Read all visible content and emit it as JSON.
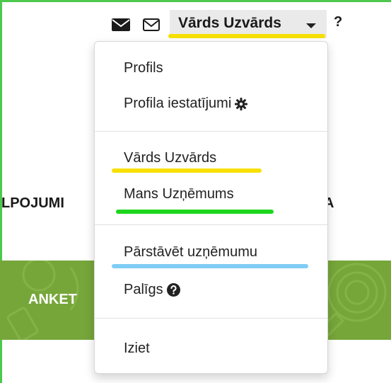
{
  "header": {
    "user_name": "Vārds Uzvārds",
    "help_label": "?",
    "icons": [
      "envelope-filled-icon",
      "envelope-outline-icon",
      "caret-down-icon"
    ]
  },
  "background": {
    "nav_left": "LPOJUMI",
    "nav_right": "A",
    "banner_text": "ANKET"
  },
  "dropdown": {
    "profile": "Profils",
    "profile_settings": "Profila iestatījumi",
    "user_name": "Vārds Uzvārds",
    "company": "Mans Uzņēmums",
    "represent_company": "Pārstāvēt uzņēmumu",
    "help": "Palīgs",
    "logout": "Iziet"
  },
  "colors": {
    "frame": "#4cc94c",
    "banner": "#76a63a",
    "highlight_yellow": "#f7e000",
    "highlight_green": "#1ed61e",
    "highlight_blue": "#7fcdf5"
  }
}
